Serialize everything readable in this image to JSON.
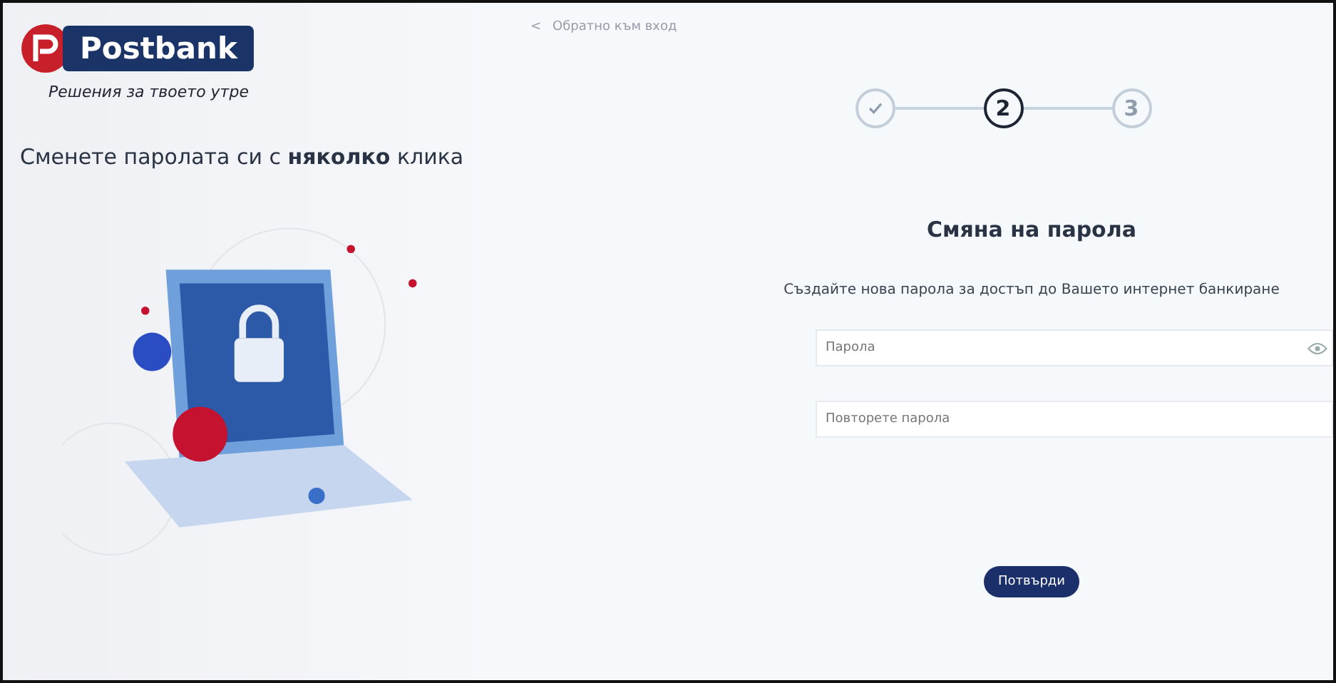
{
  "brand": {
    "name": "Postbank",
    "tagline": "Решения за твоето утре"
  },
  "left": {
    "headline": "Сменете паролата си с **няколко** клика"
  },
  "back_link": {
    "icon": "<",
    "label": "Обратно към вход"
  },
  "steps": [
    {
      "done": true,
      "selected": false
    },
    {
      "done": false,
      "selected": true,
      "number": "2"
    },
    {
      "done": false,
      "selected": false,
      "number": "3"
    }
  ],
  "form": {
    "title": "Смяна на парола",
    "subtitle": "Създайте нова парола за достъп до Вашето интернет банкиране",
    "fields": [
      {
        "placeholder": "Парола",
        "kind": "password"
      },
      {
        "placeholder": "Повторете парола",
        "kind": "plain"
      }
    ],
    "submit": "Потвърди"
  }
}
